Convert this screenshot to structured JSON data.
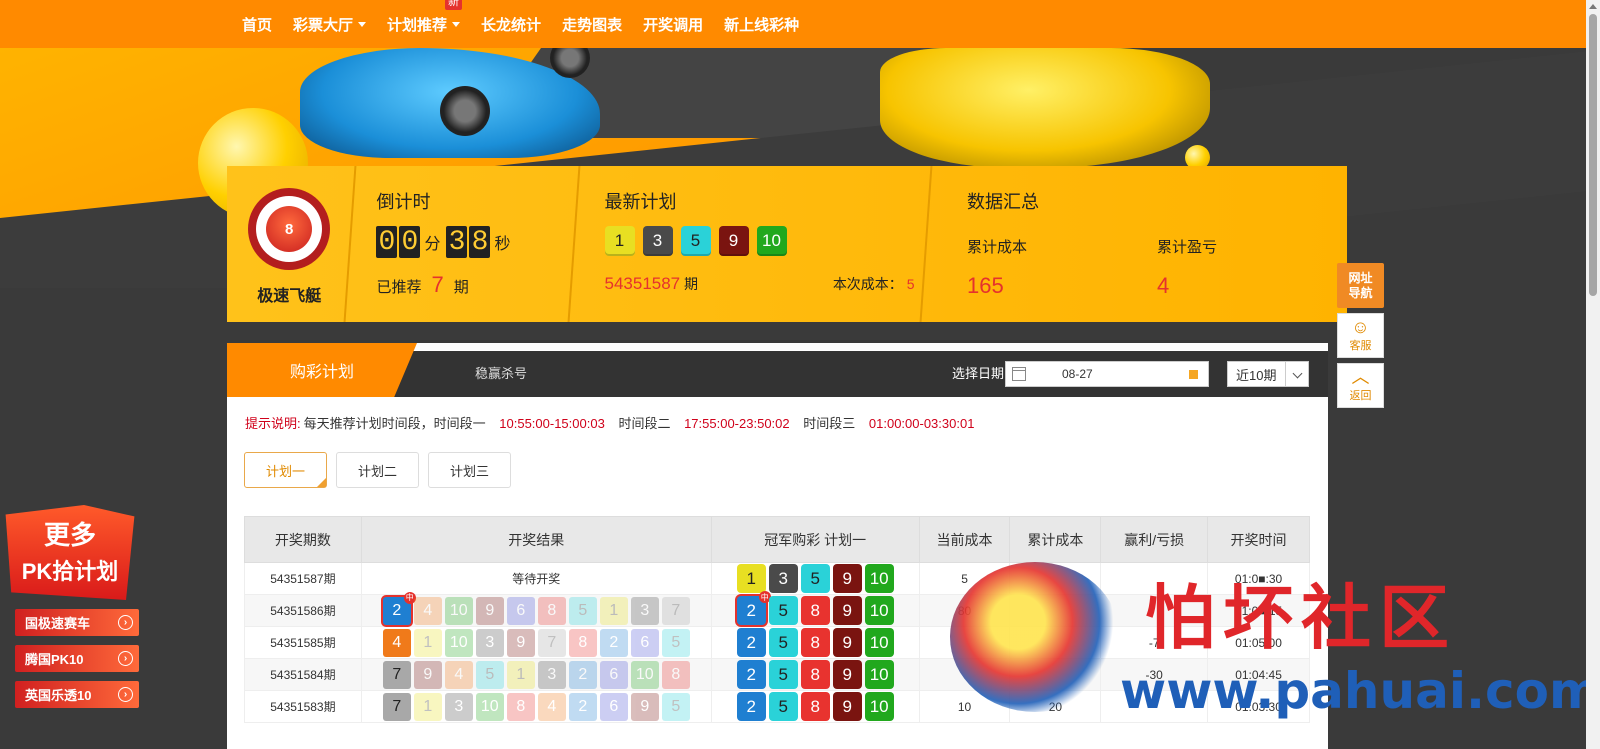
{
  "nav": {
    "items": [
      {
        "label": "首页",
        "caret": false
      },
      {
        "label": "彩票大厅",
        "caret": true
      },
      {
        "label": "计划推荐",
        "caret": true,
        "badge": "新"
      },
      {
        "label": "长龙统计",
        "caret": false
      },
      {
        "label": "走势图表",
        "caret": false
      },
      {
        "label": "开奖调用",
        "caret": false
      },
      {
        "label": "新上线彩种",
        "caret": false
      }
    ]
  },
  "game": {
    "logo_text": "8",
    "name": "极速飞艇"
  },
  "countdown": {
    "title": "倒计时",
    "min_digits": [
      "0",
      "0"
    ],
    "min_unit": "分",
    "sec_digits": [
      "3",
      "8"
    ],
    "sec_unit": "秒",
    "recommended_label": "已推荐",
    "recommended_count": "7",
    "recommended_unit": "期"
  },
  "latest_plan": {
    "title": "最新计划",
    "balls": [
      "1",
      "3",
      "5",
      "9",
      "10"
    ],
    "issue": "54351587",
    "issue_unit": "期",
    "cost_label": "本次成本：",
    "cost_value": "5"
  },
  "summary": {
    "title": "数据汇总",
    "cost_label": "累计成本",
    "cost_value": "165",
    "profit_label": "累计盈亏",
    "profit_value": "4"
  },
  "tabs": {
    "active": "购彩计划",
    "other": "稳赢杀号"
  },
  "date": {
    "label": "选择日期",
    "value": "08-27"
  },
  "period_select": {
    "value": "近10期"
  },
  "tip": {
    "prefix": "提示说明:",
    "text": "每天推荐计划时间段，时间段一",
    "seg1": "10:55:00-15:00:03",
    "seg2_label": "时间段二",
    "seg2": "17:55:00-23:50:02",
    "seg3_label": "时间段三",
    "seg3": "01:00:00-03:30:01"
  },
  "plan_buttons": [
    "计划一",
    "计划二",
    "计划三"
  ],
  "table": {
    "headers": [
      "开奖期数",
      "开奖结果",
      "冠军购彩 计划一",
      "当前成本",
      "累计成本",
      "赢利/亏损",
      "开奖时间"
    ],
    "hit_badge": "中",
    "rows": [
      {
        "issue": "54351587期",
        "result_text": "等待开奖",
        "result": [],
        "hit_index": -1,
        "plan": [
          "1",
          "3",
          "5",
          "9",
          "10"
        ],
        "plan_hit": -1,
        "cost": "5",
        "total": "",
        "profit": "",
        "time": "01:0■:30"
      },
      {
        "issue": "54351586期",
        "result_text": "",
        "result": [
          "2",
          "4",
          "10",
          "9",
          "6",
          "8",
          "5",
          "1",
          "3",
          "7"
        ],
        "hit_index": 0,
        "plan": [
          "2",
          "5",
          "8",
          "9",
          "10"
        ],
        "plan_hit": 0,
        "cost": "80",
        "total": "",
        "profit": "",
        "time": "01:0■:15"
      },
      {
        "issue": "54351585期",
        "result_text": "",
        "result": [
          "4",
          "1",
          "10",
          "3",
          "9",
          "7",
          "8",
          "2",
          "6",
          "5"
        ],
        "hit_index": -1,
        "plan": [
          "2",
          "5",
          "8",
          "9",
          "10"
        ],
        "plan_hit": -1,
        "cost": "",
        "total": "",
        "profit": "-7",
        "time": "01:05:00"
      },
      {
        "issue": "54351584期",
        "result_text": "",
        "result": [
          "7",
          "9",
          "4",
          "5",
          "1",
          "3",
          "2",
          "6",
          "10",
          "8"
        ],
        "hit_index": -1,
        "plan": [
          "2",
          "5",
          "8",
          "9",
          "10"
        ],
        "plan_hit": -1,
        "cost": "",
        "total": "",
        "profit": "-30",
        "time": "01:04:45"
      },
      {
        "issue": "54351583期",
        "result_text": "",
        "result": [
          "7",
          "1",
          "3",
          "10",
          "8",
          "4",
          "2",
          "6",
          "9",
          "5"
        ],
        "hit_index": -1,
        "plan": [
          "2",
          "5",
          "8",
          "9",
          "10"
        ],
        "plan_hit": -1,
        "cost": "10",
        "total": "20",
        "profit": "",
        "time": "01:03:30"
      }
    ]
  },
  "promo": {
    "title1": "更多",
    "title2": "PK拾计划",
    "links": [
      "国极速赛车",
      "腾国PK10",
      "英国乐透10"
    ]
  },
  "float": {
    "nav": "网址\n导航",
    "service": "客服",
    "back": "返回"
  },
  "watermark": {
    "text": "怕坏社区",
    "url": "www.pahuai.com"
  },
  "colors": {
    "accent": "#ff8a00",
    "ball": {
      "1": {
        "bg": "#e8df22",
        "fg": "#222"
      },
      "2": {
        "bg": "#1f7fd1",
        "fg": "#fff"
      },
      "3": {
        "bg": "#4a4a4a",
        "fg": "#fff"
      },
      "4": {
        "bg": "#f07a1a",
        "fg": "#fff"
      },
      "5": {
        "bg": "#2ad2d8",
        "fg": "#222"
      },
      "6": {
        "bg": "#4a53d6",
        "fg": "#fff"
      },
      "7": {
        "bg": "#a8a8a8",
        "fg": "#222"
      },
      "8": {
        "bg": "#e8332f",
        "fg": "#fff"
      },
      "9": {
        "bg": "#7a1410",
        "fg": "#fff"
      },
      "10": {
        "bg": "#21a81d",
        "fg": "#fff"
      }
    }
  }
}
